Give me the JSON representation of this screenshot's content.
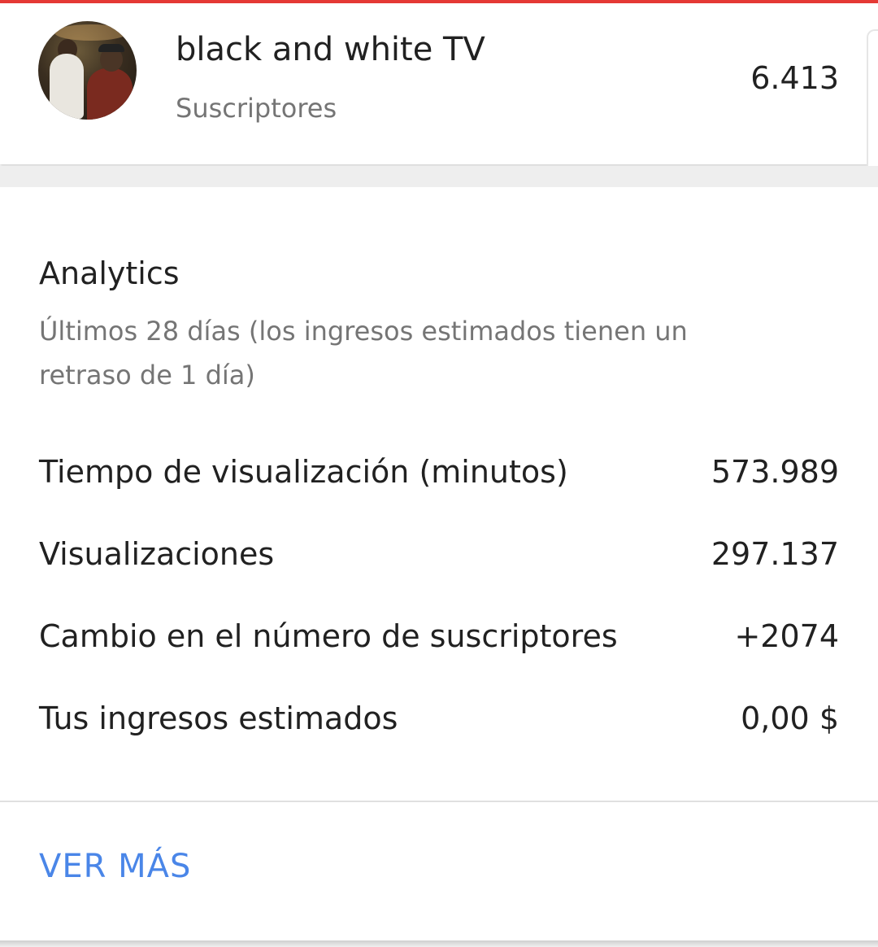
{
  "channel": {
    "name": "black and white TV",
    "subtitle": "Suscriptores",
    "subscriber_count": "6.413"
  },
  "analytics": {
    "title": "Analytics",
    "subtitle": "Últimos 28 días (los ingresos estimados tienen un retraso de 1 día)",
    "metrics": [
      {
        "label": "Tiempo de visualización (minutos)",
        "value": "573.989"
      },
      {
        "label": "Visualizaciones",
        "value": "297.137"
      },
      {
        "label": "Cambio en el número de suscriptores",
        "value": "+2074"
      },
      {
        "label": "Tus ingresos estimados",
        "value": "0,00 $"
      }
    ],
    "more_label": "VER MÁS"
  },
  "colors": {
    "accent_top": "#e53935",
    "link": "#4a86e8"
  }
}
